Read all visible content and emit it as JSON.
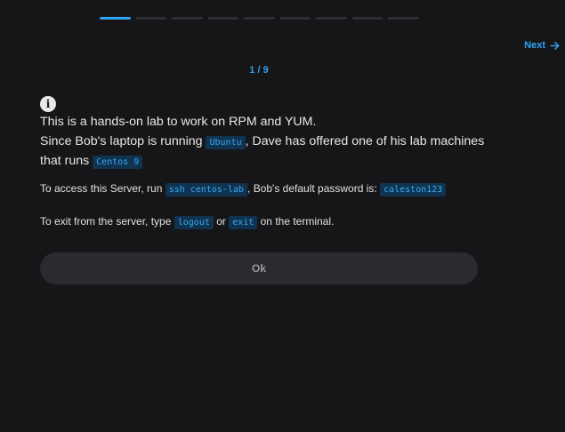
{
  "progress": {
    "current": 1,
    "total": 9
  },
  "nav": {
    "next_label": "Next"
  },
  "counter": {
    "text": "1 / 9"
  },
  "intro": {
    "line1": "This is a hands-on lab to work on RPM and YUM.",
    "line2_pre": "Since Bob's laptop is running ",
    "line2_code": "Ubuntu",
    "line2_post": ", Dave has offered one of his lab machines that runs ",
    "line2_code2": "Centos 9"
  },
  "access": {
    "pre": "To access this Server, run ",
    "code": "ssh centos-lab",
    "mid": ", Bob's default password is: ",
    "code2": "caleston123"
  },
  "exit": {
    "pre": "To exit from the server, type ",
    "code": "logout",
    "mid": " or ",
    "code2": "exit",
    "post": " on the terminal."
  },
  "ok_button": {
    "label": "Ok"
  },
  "colors": {
    "accent": "#2ea3f2",
    "background": "#161618",
    "code_bg": "#0f3350"
  }
}
